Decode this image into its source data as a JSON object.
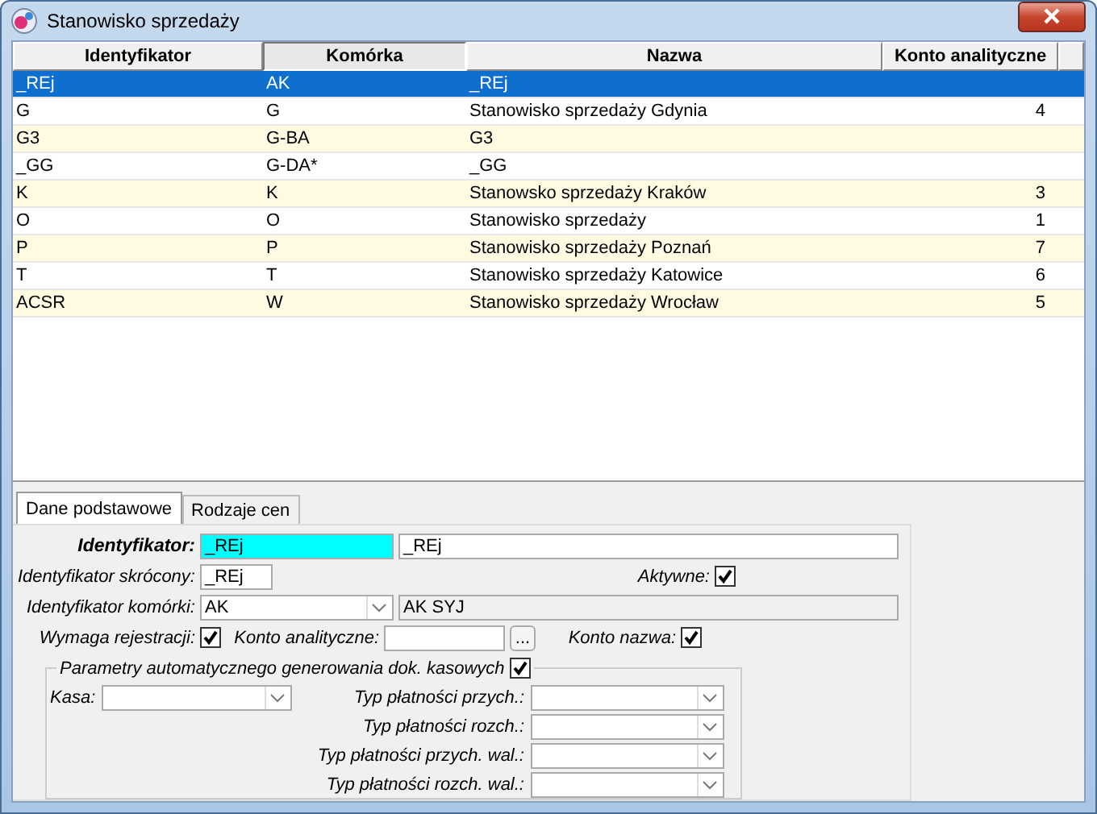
{
  "window": {
    "title": "Stanowisko sprzedaży"
  },
  "table": {
    "columns": [
      {
        "label": "Identyfikator",
        "sorted": false
      },
      {
        "label": "Komórka",
        "sorted": true
      },
      {
        "label": "Nazwa",
        "sorted": false
      },
      {
        "label": "Konto analityczne",
        "sorted": false
      }
    ],
    "rows": [
      {
        "cells": [
          "_REj",
          "AK",
          "_REj",
          ""
        ],
        "selected": true
      },
      {
        "cells": [
          "G",
          "G",
          "Stanowisko sprzedaży Gdynia",
          "4"
        ],
        "selected": false
      },
      {
        "cells": [
          "G3",
          "G-BA",
          "G3",
          ""
        ],
        "selected": false
      },
      {
        "cells": [
          "_GG",
          "G-DA*",
          "_GG",
          ""
        ],
        "selected": false
      },
      {
        "cells": [
          "K",
          "K",
          "Stanowsko sprzedaży Kraków",
          "3"
        ],
        "selected": false
      },
      {
        "cells": [
          "O",
          "O",
          "Stanowisko sprzedaży",
          "1"
        ],
        "selected": false
      },
      {
        "cells": [
          "P",
          "P",
          "Stanowisko sprzedaży Poznań",
          "7"
        ],
        "selected": false
      },
      {
        "cells": [
          "T",
          "T",
          "Stanowisko sprzedaży Katowice",
          "6"
        ],
        "selected": false
      },
      {
        "cells": [
          "ACSR",
          "W",
          "Stanowisko sprzedaży Wrocław",
          "5"
        ],
        "selected": false
      }
    ]
  },
  "tabs": [
    {
      "label": "Dane podstawowe",
      "selected": true
    },
    {
      "label": "Rodzaje cen",
      "selected": false
    }
  ],
  "form": {
    "identyfikator": {
      "label": "Identyfikator:",
      "value": "_REj",
      "name_value": "_REj"
    },
    "skrocony": {
      "label": "Identyfikator skrócony:",
      "value": "_REj"
    },
    "aktywne": {
      "label": "Aktywne:",
      "checked": true
    },
    "komorka": {
      "label": "Identyfikator komórki:",
      "value": "AK",
      "name_value": "AK SYJ"
    },
    "wymaga": {
      "label": "Wymaga rejestracji:",
      "checked": true
    },
    "konto": {
      "label": "Konto analityczne:",
      "button": "..."
    },
    "konto_nazwa": {
      "label": "Konto nazwa:",
      "checked": true
    },
    "group": {
      "label": "Parametry automatycznego generowania dok. kasowych",
      "checked": true,
      "kasa": {
        "label": "Kasa:"
      },
      "payments": [
        {
          "label": "Typ płatności przych.:"
        },
        {
          "label": "Typ płatności rozch.:"
        },
        {
          "label": "Typ płatności przych. wal.:"
        },
        {
          "label": "Typ płatności rozch. wal.:"
        }
      ]
    }
  }
}
